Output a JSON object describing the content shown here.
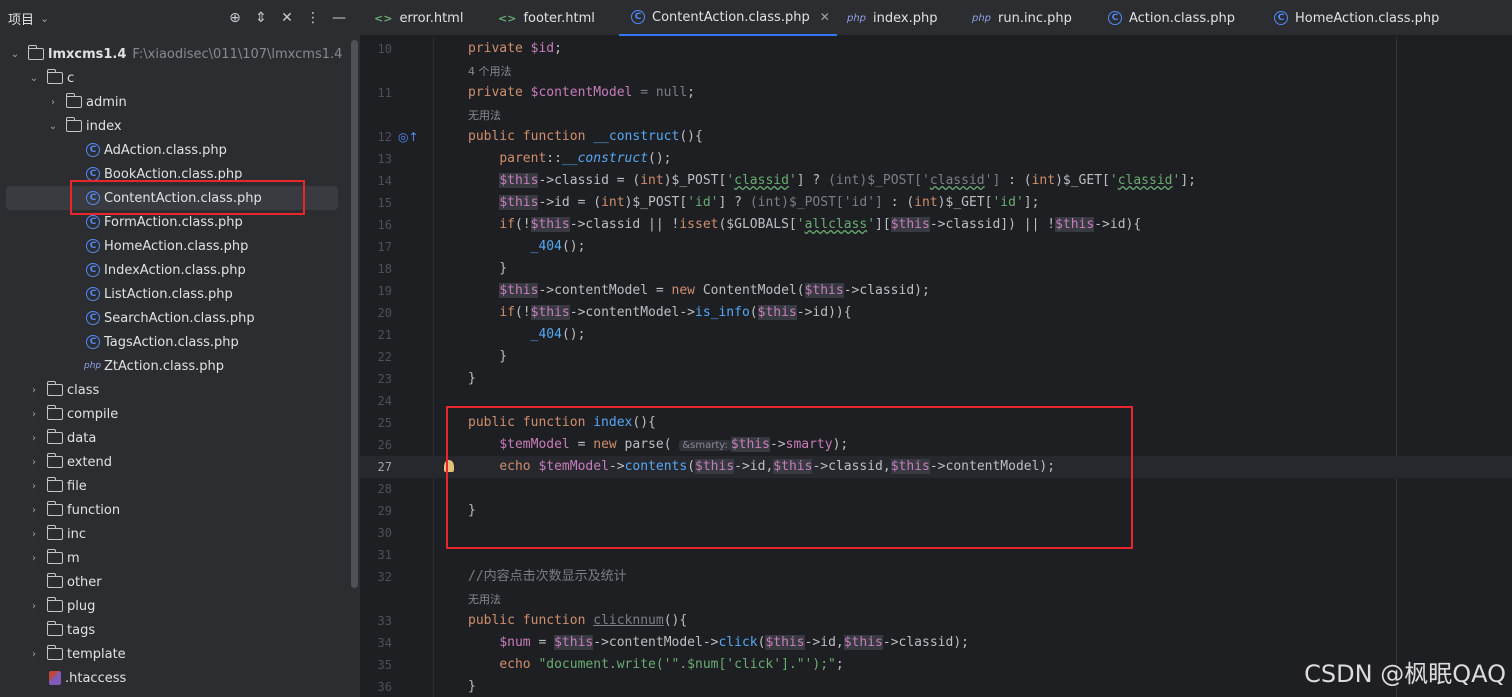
{
  "project_panel": {
    "title": "项目",
    "root": {
      "name": "lmxcms1.4",
      "path": "F:\\xiaodisec\\011\\107\\lmxcms1.4"
    },
    "folders": {
      "c": "c",
      "admin": "admin",
      "index": "index",
      "class": "class",
      "compile": "compile",
      "data": "data",
      "extend": "extend",
      "file": "file",
      "function": "function",
      "inc": "inc",
      "m": "m",
      "other": "other",
      "plug": "plug",
      "tags": "tags",
      "template": "template"
    },
    "files": [
      "AdAction.class.php",
      "BookAction.class.php",
      "ContentAction.class.php",
      "FormAction.class.php",
      "HomeAction.class.php",
      "IndexAction.class.php",
      "ListAction.class.php",
      "SearchAction.class.php",
      "TagsAction.class.php",
      "ZtAction.class.php"
    ],
    "htaccess": ".htaccess"
  },
  "tabs": [
    {
      "label": "error.html",
      "icon": "html-file-icon"
    },
    {
      "label": "footer.html",
      "icon": "html-file-icon"
    },
    {
      "label": "ContentAction.class.php",
      "icon": "class-file-icon",
      "active": true
    },
    {
      "label": "index.php",
      "icon": "php-file-icon"
    },
    {
      "label": "run.inc.php",
      "icon": "php-file-icon"
    },
    {
      "label": "Action.class.php",
      "icon": "class-file-icon"
    },
    {
      "label": "HomeAction.class.php",
      "icon": "class-file-icon"
    }
  ],
  "editor": {
    "line_numbers": [
      "10",
      "11",
      "12",
      "13",
      "14",
      "15",
      "16",
      "17",
      "18",
      "19",
      "20",
      "21",
      "22",
      "23",
      "24",
      "25",
      "26",
      "27",
      "28",
      "29",
      "30",
      "31",
      "32",
      "33",
      "34",
      "35",
      "36"
    ],
    "current_line": "27",
    "hints": {
      "usages_4": "4 个用法",
      "no_usages": "无用法"
    },
    "inlay_smarty": "&smarty:",
    "comment_32": "//内容点击次数显示及统计",
    "code_str_35": "\"document.write('\".$num['click'].\"');\""
  },
  "watermark": "CSDN @枫眠QAQ",
  "colors": {
    "accent": "#3574f0",
    "highlight_box": "#e8262b"
  }
}
